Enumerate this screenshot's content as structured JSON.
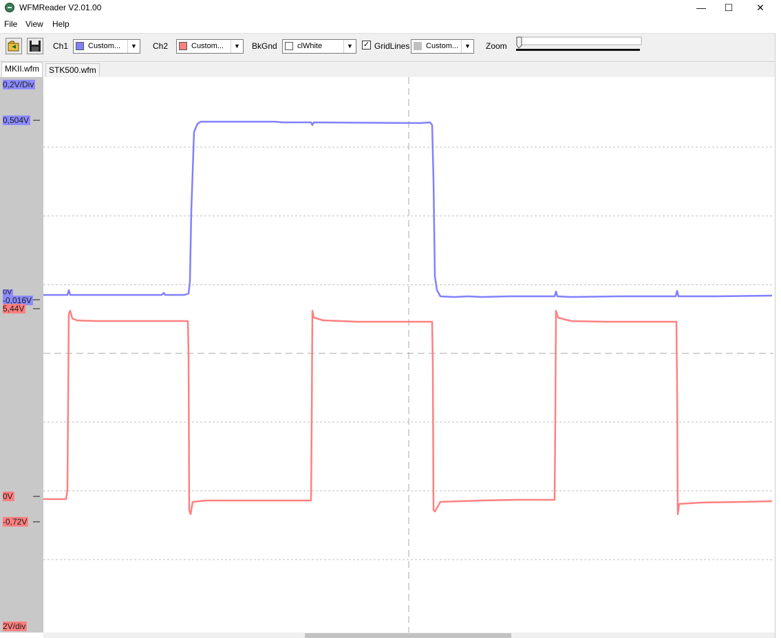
{
  "window": {
    "title": "WFMReader V2.01.00",
    "minimize": "—",
    "maximize": "☐",
    "close": "✕"
  },
  "menu": [
    "File",
    "View",
    "Help"
  ],
  "toolbar": {
    "open_icon": "open-folder-icon",
    "save_icon": "floppy-disk-icon",
    "ch1_label": "Ch1",
    "ch1_value": "Custom...",
    "ch1_color": "#8080ff",
    "ch2_label": "Ch2",
    "ch2_value": "Custom...",
    "ch2_color": "#ff8080",
    "bkgnd_label": "BkGnd",
    "bkgnd_value": "clWhite",
    "bkgnd_color": "#ffffff",
    "gridlines_label": "GridLines",
    "gridlines_checked": true,
    "grid_value": "Custom...",
    "grid_color": "#c0c0c0",
    "zoom_label": "Zoom"
  },
  "tabs": [
    "MKII.wfm",
    "STK500.wfm"
  ],
  "scope": {
    "ch1": {
      "scale": "0,2V/Div",
      "high_label": "0,504V",
      "low_label": "-0,016V",
      "zero_label": "0V",
      "color": "#8080ff"
    },
    "ch2": {
      "scale": "2V/div",
      "high_label": "5,44V",
      "zero_label": "0V",
      "low_label": "-0,72V",
      "color": "#ff8080"
    },
    "grid_lines": true
  }
}
